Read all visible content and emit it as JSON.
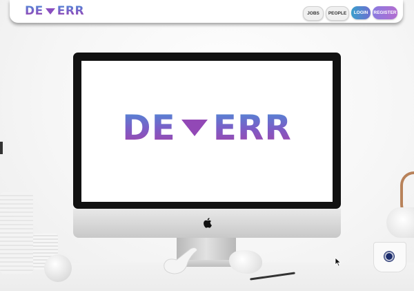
{
  "brand": {
    "left": "DE",
    "right": "ERR"
  },
  "nav": {
    "jobs": "JOBS",
    "people": "PEOPLE",
    "login": "LOGIN",
    "register": "REGISTER"
  },
  "hero": {
    "left": "DE",
    "right": "ERR"
  },
  "colors": {
    "gradient_top": "#4a8fd8",
    "gradient_mid": "#7a5fc7",
    "gradient_bottom": "#a640a8",
    "login_start": "#3a9fcc",
    "register_end": "#b36dd0"
  },
  "icons": {
    "logo_mark": "down-triangle-icon",
    "monitor_logo": "apple-icon",
    "pointer": "mouse-cursor-icon"
  }
}
